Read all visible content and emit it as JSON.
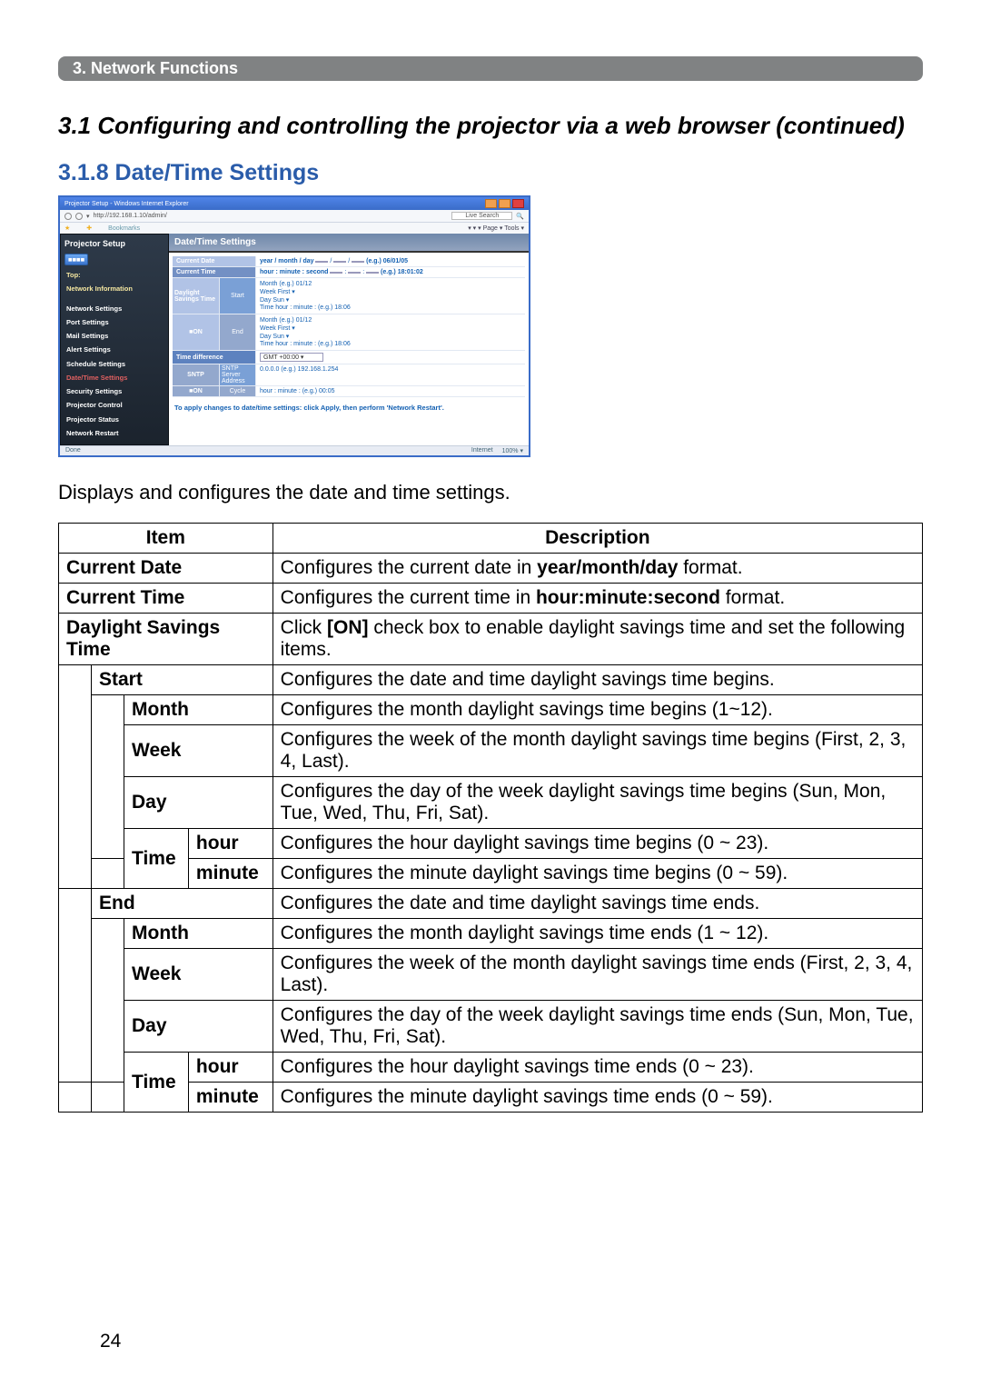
{
  "breadcrumb": "3. Network Functions",
  "section_title": "3.1 Configuring and controlling the projector via a web browser (continued)",
  "subsection_title": "3.1.8 Date/Time Settings",
  "intro": "Displays and configures the date and time settings.",
  "page_number": "24",
  "screenshot": {
    "window_title": "Projector Setup - Windows Internet Explorer",
    "addr_hint": "http://192.168.1.10/admin/",
    "searchbox": "Live Search",
    "link_bookmarks": "Bookmarks",
    "right_tags": "▾ ▾    ▾ Page ▾ Tools ▾",
    "nav": {
      "brand": "Projector Setup",
      "sel": "■■■■",
      "items": [
        "Top:",
        "Network Information",
        "Network Settings",
        "Port Settings",
        "Mail Settings",
        "Alert Settings",
        "Schedule Settings",
        "Date/Time Settings",
        "Security Settings",
        "Projector Control",
        "Projector Status",
        "Network Restart"
      ]
    },
    "panel_title": "Date/Time Settings",
    "rows": {
      "current_date": {
        "label": "Current Date",
        "hint": "year / month / day",
        "eg": "(e.g.) 06/01/05"
      },
      "current_time": {
        "label": "Current Time",
        "hint": "hour : minute : second",
        "eg": "(e.g.) 18:01:02"
      },
      "dst": {
        "label": "Daylight Savings Time",
        "chk": "■ON"
      },
      "start": {
        "label": "Start",
        "month": "Month",
        "month_eg": "(e.g.) 01/12",
        "week": "Week",
        "week_hint": "First ▾",
        "day": "Day",
        "day_hint": "Sun ▾",
        "time": "Time  hour : minute",
        "time_eg": "(e.g.) 18:06"
      },
      "end": {
        "label": "End",
        "month": "Month",
        "month_eg": "(e.g.) 01/12",
        "week": "Week",
        "week_hint": "First ▾",
        "day": "Day",
        "day_hint": "Sun ▾",
        "time": "Time  hour : minute",
        "time_eg": "(e.g.) 18:06"
      },
      "timediff": {
        "label": "Time difference",
        "val": "GMT +00:00 ▾"
      },
      "sntp": {
        "label": "SNTP",
        "chk": "■ON",
        "sub1": "SNTP Server Address",
        "sub1_val": "0.0.0.0",
        "sub1_eg": "(e.g.) 192.168.1.254",
        "sub2": "Cycle",
        "sub2_hint": "hour : minute",
        "sub2_eg": "(e.g.) 00:05"
      }
    },
    "note": "To apply changes to date/time settings: click Apply, then perform 'Network Restart'.",
    "status_left": "Done",
    "status_r1": "Internet",
    "status_r2": "100% ▾"
  },
  "table": {
    "head_item": "Item",
    "head_desc": "Description",
    "current_date": {
      "item": "Current Date",
      "desc_a": "Configures the current date in ",
      "desc_b": "year/month/day",
      "desc_c": " format."
    },
    "current_time": {
      "item": "Current Time",
      "desc_a": "Configures the current time in ",
      "desc_b": "hour:minute:second",
      "desc_c": " format."
    },
    "dst": {
      "item": "Daylight Savings Time",
      "desc_a": "Click ",
      "desc_b": "[ON]",
      "desc_c": " check box to enable daylight savings time and set the following items."
    },
    "start": {
      "item": "Start",
      "desc": "Configures the date and time daylight savings time begins."
    },
    "start_month": {
      "item": "Month",
      "desc": "Configures the month daylight savings time begins (1~12)."
    },
    "start_week": {
      "item": "Week",
      "desc": "Configures the week of the month daylight savings time begins (First, 2, 3, 4, Last)."
    },
    "start_day": {
      "item": "Day",
      "desc": "Configures the day of the week daylight savings time begins (Sun, Mon, Tue, Wed, Thu, Fri, Sat)."
    },
    "start_time": {
      "item": "Time"
    },
    "start_hour": {
      "item": "hour",
      "desc": "Configures the hour daylight savings time begins (0 ~ 23)."
    },
    "start_minute": {
      "item": "minute",
      "desc": "Configures the minute daylight savings time begins (0 ~ 59)."
    },
    "end": {
      "item": "End",
      "desc": "Configures the date and time daylight savings time ends."
    },
    "end_month": {
      "item": "Month",
      "desc": "Configures the month daylight savings time ends (1 ~ 12)."
    },
    "end_week": {
      "item": "Week",
      "desc": "Configures the week of the month daylight savings time ends (First, 2, 3, 4, Last)."
    },
    "end_day": {
      "item": "Day",
      "desc": "Configures the day of the week daylight savings time ends (Sun, Mon, Tue, Wed, Thu, Fri, Sat)."
    },
    "end_time": {
      "item": "Time"
    },
    "end_hour": {
      "item": "hour",
      "desc": "Configures the hour daylight savings time ends (0 ~ 23)."
    },
    "end_minute": {
      "item": "minute",
      "desc": "Configures the minute daylight savings time ends (0 ~ 59)."
    }
  }
}
